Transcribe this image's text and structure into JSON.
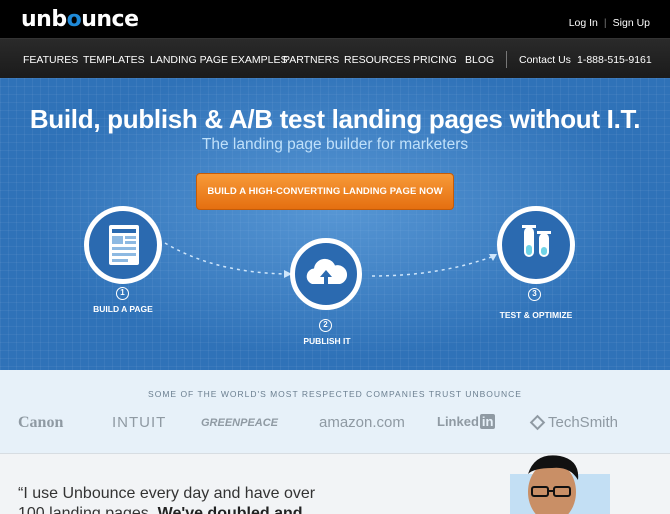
{
  "brand": {
    "logo_a": "unb",
    "logo_o": "o",
    "logo_b": "unce"
  },
  "auth": {
    "login": "Log In",
    "signup": "Sign Up"
  },
  "nav": {
    "features": "FEATURES",
    "templates": "TEMPLATES",
    "examples": "LANDING PAGE EXAMPLES",
    "partners": "PARTNERS",
    "resources": "RESOURCES",
    "pricing": "PRICING",
    "blog": "BLOG",
    "contact": "Contact Us",
    "phone": "1-888-515-9161"
  },
  "hero": {
    "headline": "Build, publish & A/B test landing pages without I.T.",
    "subline": "The landing page builder for marketers",
    "cta": "BUILD A HIGH-CONVERTING LANDING PAGE NOW",
    "steps": [
      {
        "num": "1",
        "label": "BUILD A PAGE"
      },
      {
        "num": "2",
        "label": "PUBLISH IT"
      },
      {
        "num": "3",
        "label": "TEST & OPTIMIZE"
      }
    ]
  },
  "trust": {
    "heading": "SOME OF THE WORLD'S MOST RESPECTED COMPANIES TRUST UNBOUNCE",
    "logos": {
      "canon": "Canon",
      "intuit": "INTUIT",
      "greenpeace": "GREENPEACE",
      "amazon": "amazon.com",
      "linkedin": "Linked",
      "linkedin_in": "in",
      "techsmith": "TechSmith"
    }
  },
  "testimonial": {
    "line1": "“I use Unbounce every day and have over",
    "line2_normal": "100 landing pages. ",
    "line2_bold": "We've doubled and"
  },
  "colors": {
    "accent": "#1f8ad8",
    "hero_bg": "#2f72b8",
    "cta": "#ee8423",
    "logos_bg": "#e7f1f9"
  }
}
